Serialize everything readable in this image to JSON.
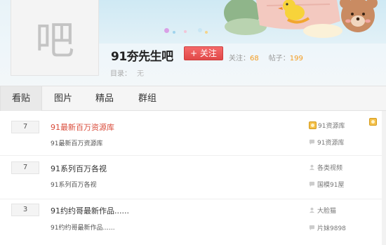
{
  "header": {
    "avatar_char": "吧",
    "forum_name": "91夯先生吧",
    "follow_label": "+ 关注",
    "follow_count_label": "关注：",
    "follow_count": "68",
    "post_count_label": "帖子：",
    "post_count": "199",
    "catalog_label": "目录：",
    "catalog_value": "无"
  },
  "tabs": [
    {
      "label": "看贴",
      "active": true
    },
    {
      "label": "图片",
      "active": false
    },
    {
      "label": "精品",
      "active": false
    },
    {
      "label": "群组",
      "active": false
    }
  ],
  "threads": [
    {
      "reply_count": "7",
      "title": "91最新百万资源库",
      "title_color": "#d94b3a",
      "abstract": "91最新百万资源库",
      "author": "91资源库",
      "author_icon": "member-badge-icon",
      "last_reply": "91资源库"
    },
    {
      "reply_count": "7",
      "title": "91系列百万各视",
      "title_color": "#333333",
      "abstract": "91系列百万各视",
      "author": "各类视频",
      "author_icon": "user-icon",
      "last_reply": "国模91屋"
    },
    {
      "reply_count": "3",
      "title": "91约约哥最新作品......",
      "title_color": "#333333",
      "abstract": "91约约哥最新作品......",
      "author": "大脸猫",
      "author_icon": "user-icon",
      "last_reply": "片妹9898"
    }
  ],
  "colors": {
    "follow_button": "#e04848",
    "stat_number": "#f39b1e",
    "hot_title": "#d94b3a"
  }
}
